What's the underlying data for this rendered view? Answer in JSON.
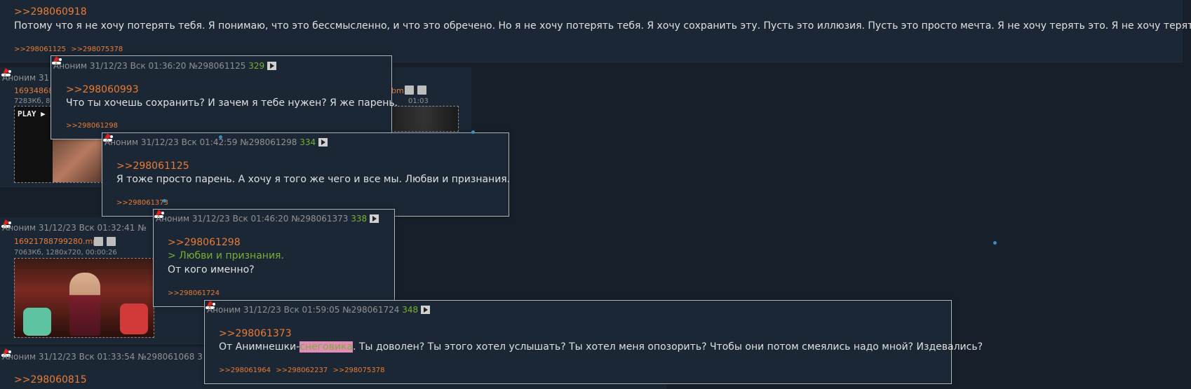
{
  "top_post": {
    "quote": ">>298060918",
    "text": "Потому что я не хочу потерять тебя. Я понимаю, что это бессмысленно, и что это обречено. Но я не хочу потерять тебя. Я хочу сохранить эту. Пусть это иллюзия. Пусть это просто мечта. Я не хочу терять это. Я не хочу терять тебя.",
    "replies": [
      ">>298061125",
      ">>298075378"
    ]
  },
  "bg_post_1": {
    "author": "Аноним 31",
    "file_name": "169348680",
    "file_meta": "7283Кб, 8",
    "file_name_right": "bm",
    "file_meta_right": "01:03",
    "thumb_label": "PLAY ▶"
  },
  "bg_post_2": {
    "header": "Аноним 31/12/23 Вск 01:32:41 №",
    "file_name": "16921788799280.mp4",
    "file_meta": "7063Кб, 1280x720, 00:00:26"
  },
  "bg_post_3": {
    "header": "Аноним 31/12/23 Вск 01:33:54 №298061068 3",
    "quote": ">>298060815"
  },
  "preview_1": {
    "header": "Аноним 31/12/23 Вск 01:36:20 №298061125",
    "count": "329",
    "quote": ">>298060993",
    "text": "Что ты хочешь сохранить? И зачем я тебе нужен? Я же парень.",
    "replies": [
      ">>298061298"
    ]
  },
  "preview_2": {
    "header": "Аноним 31/12/23 Вск 01:42:59 №298061298",
    "count": "334",
    "quote": ">>298061125",
    "text": "Я тоже просто парень. А хочу я того же чего и все мы. Любви и признания.",
    "replies": [
      ">>298061373"
    ]
  },
  "preview_3": {
    "header": "Аноним 31/12/23 Вск 01:46:20 №298061373",
    "count": "338",
    "quote": ">>298061298",
    "greentext": "> Любви и признания.",
    "text": "От кого именно?",
    "replies": [
      ">>298061724"
    ]
  },
  "preview_4": {
    "header": "Аноним 31/12/23 Вск 01:59:05 №298061724",
    "count": "348",
    "quote": ">>298061373",
    "text_before": "От Анимнешки-",
    "text_highlight": "снеговика",
    "text_after": ". Ты доволен? Ты этого хотел услышать? Ты хотел меня опозорить? Чтобы они потом смеялись надо мной? Издевались?",
    "replies": [
      ">>298061964",
      ">>298062237",
      ">>298075378"
    ]
  },
  "colors": {
    "background": "#17202a",
    "post": "#1b2735",
    "link": "#ea7c35",
    "greentext": "#79b031",
    "highlight": "#e48bb9"
  }
}
